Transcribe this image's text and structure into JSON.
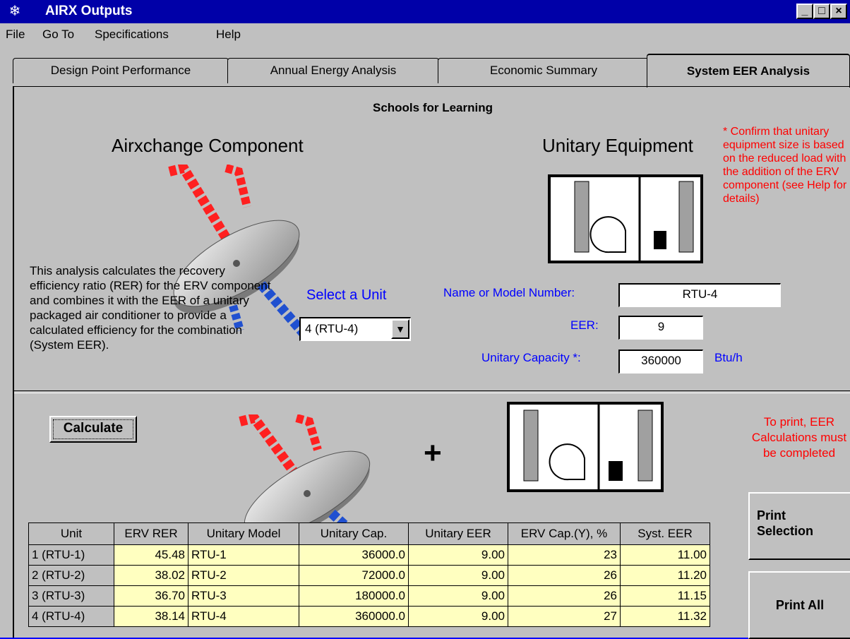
{
  "window": {
    "title": "AIRX Outputs",
    "controls": {
      "minimize": "_",
      "maximize": "□",
      "close": "×"
    }
  },
  "menu": [
    {
      "label": "File"
    },
    {
      "label": "Go To"
    },
    {
      "label": "Specifications"
    },
    {
      "label": "Help"
    }
  ],
  "tabs": [
    {
      "label": "Design Point Performance",
      "active": false
    },
    {
      "label": "Annual Energy Analysis",
      "active": false
    },
    {
      "label": "Economic Summary",
      "active": false
    },
    {
      "label": "System EER Analysis",
      "active": true
    }
  ],
  "project_title": "Schools for Learning",
  "airxchange_heading": "Airxchange Component",
  "unitary_heading": "Unitary Equipment",
  "confirm_note": "* Confirm that unitary equipment size is based on the reduced load with the addition of the ERV component (see Help for details)",
  "description": "This analysis calculates the recovery efficiency ratio (RER) for the ERV component and combines it with the EER of a unitary packaged air conditioner to provide a calculated efficiency for the combination (System EER).",
  "select_unit": {
    "label": "Select a Unit",
    "value": "4 (RTU-4)"
  },
  "fields": {
    "name_label": "Name or Model Number:",
    "name_value": "RTU-4",
    "eer_label": "EER:",
    "eer_value": "9",
    "capacity_label": "Unitary Capacity *:",
    "capacity_value": "360000",
    "capacity_unit": "Btu/h"
  },
  "calculate_label": "Calculate",
  "plus_sign": "+",
  "print_note": "To print, EER Calculations must be completed",
  "print_selection_label": "Print Selection",
  "print_all_label": "Print All",
  "colors": {
    "title_bar": "#0000a8",
    "window": "#c0c0c0",
    "accent_blue": "#0000ff",
    "note_red": "#ff0000",
    "grid_yellow": "#ffffc0"
  },
  "table": {
    "headers": [
      "Unit",
      "ERV RER",
      "Unitary Model",
      "Unitary Cap.",
      "Unitary EER",
      "ERV Cap.(Y), %",
      "Syst. EER"
    ],
    "rows": [
      [
        "1 (RTU-1)",
        "45.48",
        "RTU-1",
        "36000.0",
        "9.00",
        "23",
        "11.00"
      ],
      [
        "2 (RTU-2)",
        "38.02",
        "RTU-2",
        "72000.0",
        "9.00",
        "26",
        "11.20"
      ],
      [
        "3 (RTU-3)",
        "36.70",
        "RTU-3",
        "180000.0",
        "9.00",
        "26",
        "11.15"
      ],
      [
        "4 (RTU-4)",
        "38.14",
        "RTU-4",
        "360000.0",
        "9.00",
        "27",
        "11.32"
      ]
    ]
  }
}
